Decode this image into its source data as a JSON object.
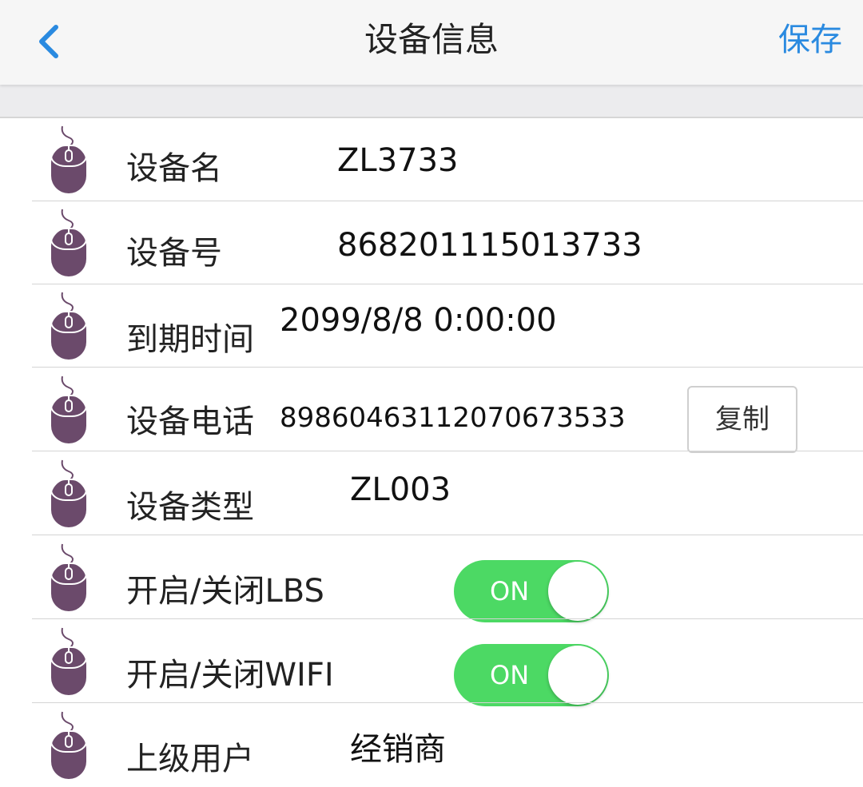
{
  "header": {
    "title": "设备信息",
    "save_label": "保存",
    "back_icon": "chevron-left-icon",
    "accent_color": "#2a8ae0"
  },
  "rows": [
    {
      "label": "设备名",
      "value": "ZL3733"
    },
    {
      "label": "设备号",
      "value": "868201115013733"
    },
    {
      "label": "到期时间",
      "value": "2099/8/8 0:00:00"
    },
    {
      "label": "设备电话",
      "value": "89860463112070673533",
      "action_label": "复制"
    },
    {
      "label": "设备类型",
      "value": "ZL003"
    },
    {
      "label": "开启/关闭LBS",
      "toggle": "ON"
    },
    {
      "label": "开启/关闭WIFI",
      "toggle": "ON"
    },
    {
      "label": "上级用户",
      "value": "经销商"
    }
  ],
  "row_icon": "mouse-icon",
  "toggle_color": "#4cd964",
  "icon_color": "#6b4a6b"
}
